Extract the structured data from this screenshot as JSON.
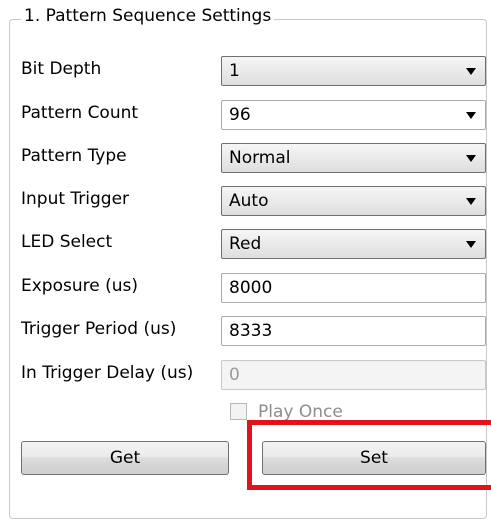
{
  "group": {
    "title": "1. Pattern Sequence Settings"
  },
  "fields": {
    "bit_depth": {
      "label": "Bit Depth",
      "value": "1"
    },
    "pattern_count": {
      "label": "Pattern Count",
      "value": "96"
    },
    "pattern_type": {
      "label": "Pattern Type",
      "value": "Normal"
    },
    "input_trigger": {
      "label": "Input Trigger",
      "value": "Auto"
    },
    "led_select": {
      "label": "LED Select",
      "value": "Red"
    },
    "exposure": {
      "label": "Exposure (us)",
      "value": "8000"
    },
    "trigger_period": {
      "label": "Trigger Period (us)",
      "value": "8333"
    },
    "in_trigger_delay": {
      "label": "In Trigger Delay (us)",
      "value": "0",
      "enabled": false
    }
  },
  "play_once": {
    "label": "Play Once",
    "checked": false,
    "enabled": false
  },
  "buttons": {
    "get": "Get",
    "set": "Set"
  },
  "colors": {
    "highlight": "#e3111b"
  }
}
